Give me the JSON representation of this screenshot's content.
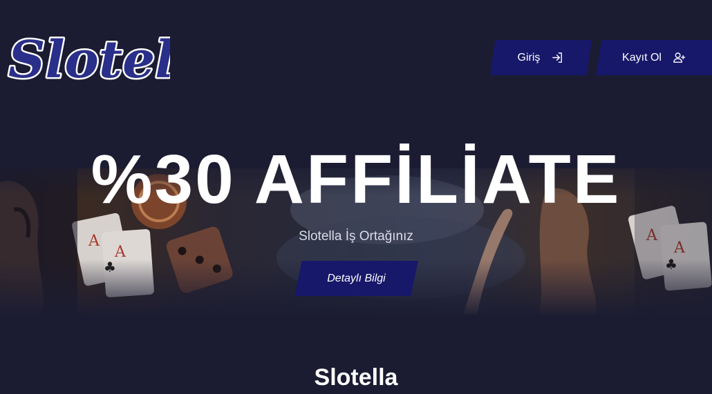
{
  "header": {
    "logo_text": "Slotella",
    "login": {
      "label": "Giriş",
      "icon": "login-icon"
    },
    "register": {
      "label": "Kayıt Ol",
      "icon": "add-user-icon"
    }
  },
  "hero": {
    "title": "%30 AFFİLİATE",
    "subtitle": "Slotella İş Ortağınız",
    "cta_label": "Detaylı Bilgi"
  },
  "section": {
    "title": "Slotella"
  },
  "colors": {
    "background": "#1b1c32",
    "button": "#17186a",
    "logo_fill": "#2a2f8a",
    "logo_outline": "#ffffff"
  }
}
